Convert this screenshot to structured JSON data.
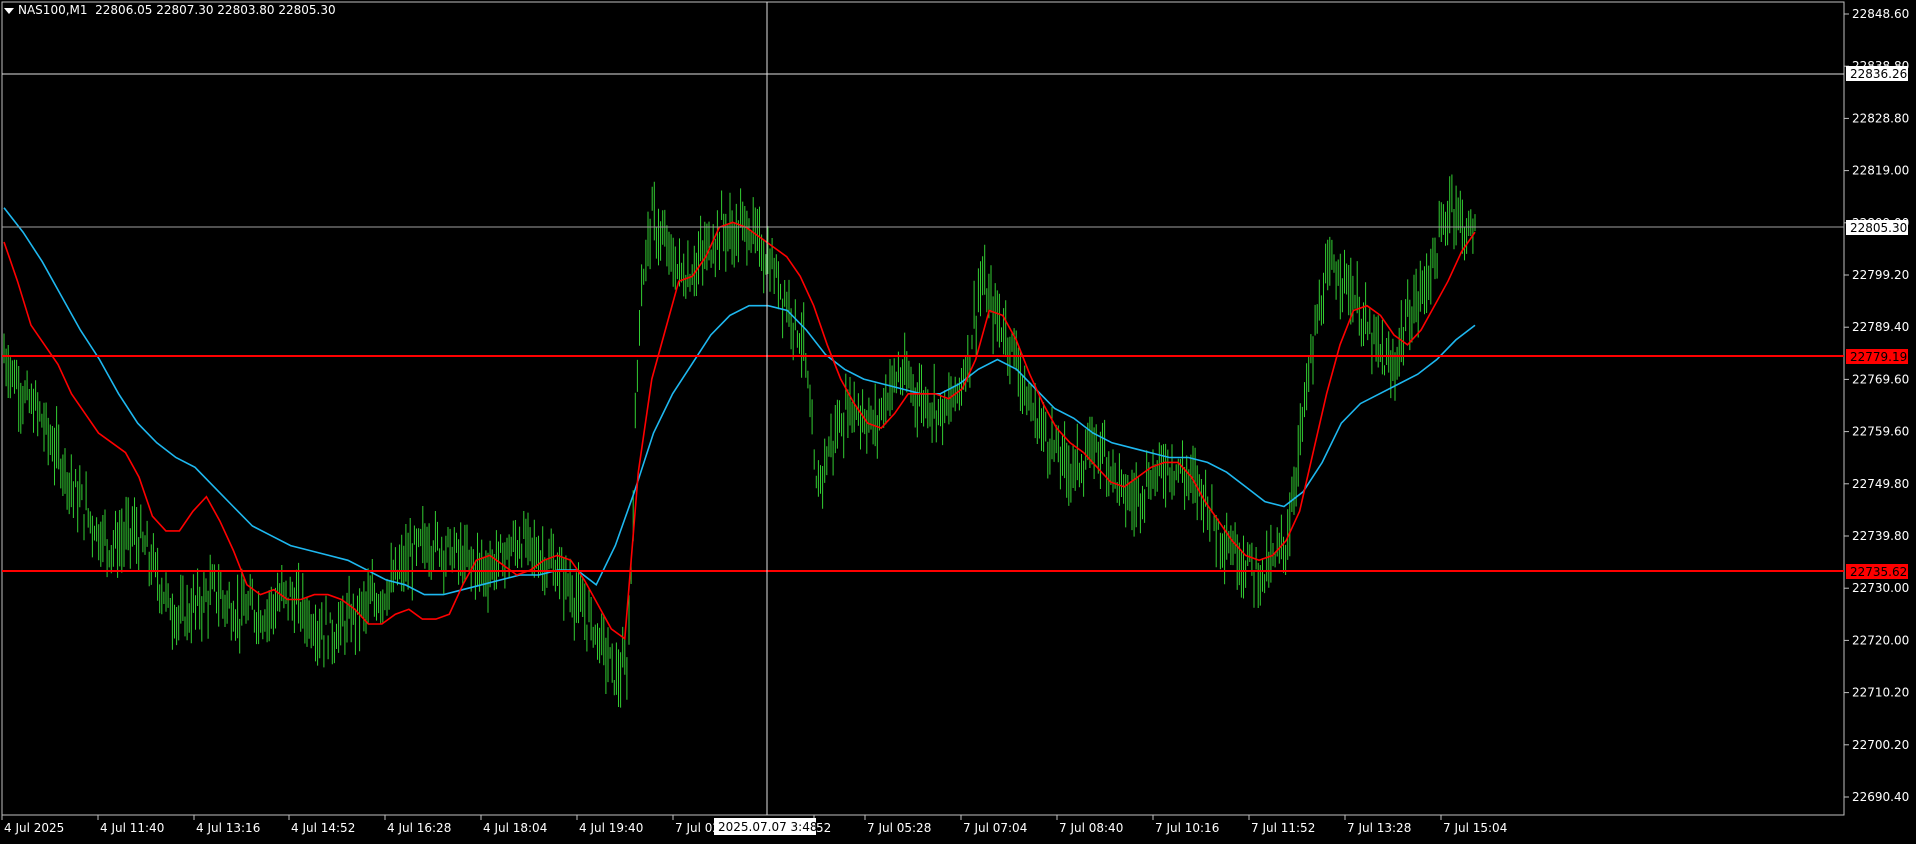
{
  "header": {
    "symbol": "NAS100,M1",
    "ohlc": "22806.05 22807.30 22803.80 22805.30"
  },
  "y_axis": {
    "ticks": [
      "22848.60",
      "22838.80",
      "22828.80",
      "22819.00",
      "22809.00",
      "22799.20",
      "22789.40",
      "22769.60",
      "22759.60",
      "22749.80",
      "22739.80",
      "22730.00",
      "22720.00",
      "22710.20",
      "22700.20",
      "22690.40"
    ]
  },
  "x_axis": {
    "ticks": [
      "4 Jul 2025",
      "4 Jul 11:40",
      "4 Jul 13:16",
      "4 Jul 14:52",
      "4 Jul 16:28",
      "4 Jul 18:04",
      "4 Jul 19:40",
      "7 Jul 02",
      "52",
      "7 Jul 05:28",
      "7 Jul 07:04",
      "7 Jul 08:40",
      "7 Jul 10:16",
      "7 Jul 11:52",
      "7 Jul 13:28",
      "7 Jul 15:04"
    ]
  },
  "crosshair": {
    "time_label": "2025.07.07 3:48",
    "price_label": "22836.26"
  },
  "price_lines": {
    "current": "22805.30",
    "upper_level": "22779.19",
    "lower_level": "22735.62"
  },
  "colors": {
    "background": "#000000",
    "candle": "#32cd32",
    "fast_ma": "#ff0000",
    "slow_ma": "#1eb8f0",
    "level_line": "#ff0000",
    "grid": "#c0c0c0"
  },
  "chart_data": {
    "type": "candlestick",
    "title": "NAS100,M1",
    "ylim": [
      22686,
      22852
    ],
    "series": [
      {
        "name": "",
        "values_key": "close_path"
      },
      {
        "name": "",
        "values_key": "fast_ma"
      },
      {
        "name": "",
        "values_key": "slow_ma"
      }
    ],
    "close_path": [
      22780,
      22775,
      22770,
      22768,
      22762,
      22758,
      22752,
      22748,
      22744,
      22741,
      22742,
      22744,
      22740,
      22735,
      22729,
      22726,
      22728,
      22730,
      22732,
      22729,
      22727,
      22728,
      22727,
      22729,
      22731,
      22729,
      22726,
      22724,
      22723,
      22725,
      22727,
      22729,
      22731,
      22733,
      22737,
      22740,
      22742,
      22741,
      22740,
      22738,
      22737,
      22736,
      22738,
      22740,
      22742,
      22740,
      22738,
      22736,
      22733,
      22728,
      22725,
      22720,
      22714,
      22716,
      22790,
      22808,
      22803,
      22798,
      22796,
      22799,
      22802,
      22806,
      22804,
      22807,
      22803,
      22799,
      22794,
      22788,
      22782,
      22752,
      22760,
      22766,
      22770,
      22768,
      22765,
      22772,
      22776,
      22774,
      22771,
      22770,
      22768,
      22772,
      22780,
      22795,
      22789,
      22785,
      22780,
      22770,
      22766,
      22762,
      22758,
      22757,
      22759,
      22762,
      22758,
      22752,
      22750,
      22754,
      22756,
      22758,
      22756,
      22754,
      22752,
      22745,
      22742,
      22739,
      22737,
      22735,
      22738,
      22742,
      22760,
      22778,
      22792,
      22798,
      22796,
      22790,
      22784,
      22780,
      22776,
      22786,
      22790,
      22796,
      22803,
      22812,
      22806,
      22805
    ],
    "fast_ma": [
      22803,
      22795,
      22786,
      22782,
      22778,
      22772,
      22768,
      22764,
      22762,
      22760,
      22755,
      22747,
      22744,
      22744,
      22748,
      22751,
      22746,
      22740,
      22733,
      22731,
      22732,
      22730,
      22730,
      22731,
      22731,
      22730,
      22728,
      22725,
      22725,
      22727,
      22728,
      22726,
      22726,
      22727,
      22733,
      22738,
      22739,
      22737,
      22735,
      22736,
      22738,
      22739,
      22738,
      22734,
      22729,
      22724,
      22722,
      22756,
      22775,
      22785,
      22795,
      22796,
      22800,
      22806,
      22807,
      22806,
      22804,
      22802,
      22800,
      22796,
      22790,
      22782,
      22775,
      22770,
      22766,
      22765,
      22768,
      22772,
      22772,
      22772,
      22771,
      22773,
      22779,
      22789,
      22788,
      22783,
      22776,
      22770,
      22765,
      22762,
      22760,
      22757,
      22754,
      22753,
      22755,
      22757,
      22758,
      22758,
      22755,
      22750,
      22746,
      22742,
      22739,
      22738,
      22739,
      22742,
      22748,
      22760,
      22772,
      22782,
      22789,
      22790,
      22788,
      22784,
      22782,
      22785,
      22790,
      22795,
      22801,
      22805
    ],
    "slow_ma": [
      22810,
      22805,
      22799,
      22792,
      22785,
      22779,
      22772,
      22766,
      22762,
      22759,
      22757,
      22753,
      22749,
      22745,
      22743,
      22741,
      22740,
      22739,
      22738,
      22736,
      22734,
      22733,
      22731,
      22731,
      22732,
      22733,
      22734,
      22735,
      22735,
      22736,
      22736,
      22733,
      22741,
      22752,
      22764,
      22772,
      22778,
      22784,
      22788,
      22790,
      22790,
      22789,
      22785,
      22780,
      22777,
      22775,
      22774,
      22773,
      22772,
      22772,
      22774,
      22777,
      22779,
      22777,
      22773,
      22769,
      22767,
      22764,
      22762,
      22761,
      22760,
      22759,
      22759,
      22758,
      22756,
      22753,
      22750,
      22749,
      22752,
      22758,
      22766,
      22770,
      22772,
      22774,
      22776,
      22779,
      22783,
      22786
    ]
  }
}
